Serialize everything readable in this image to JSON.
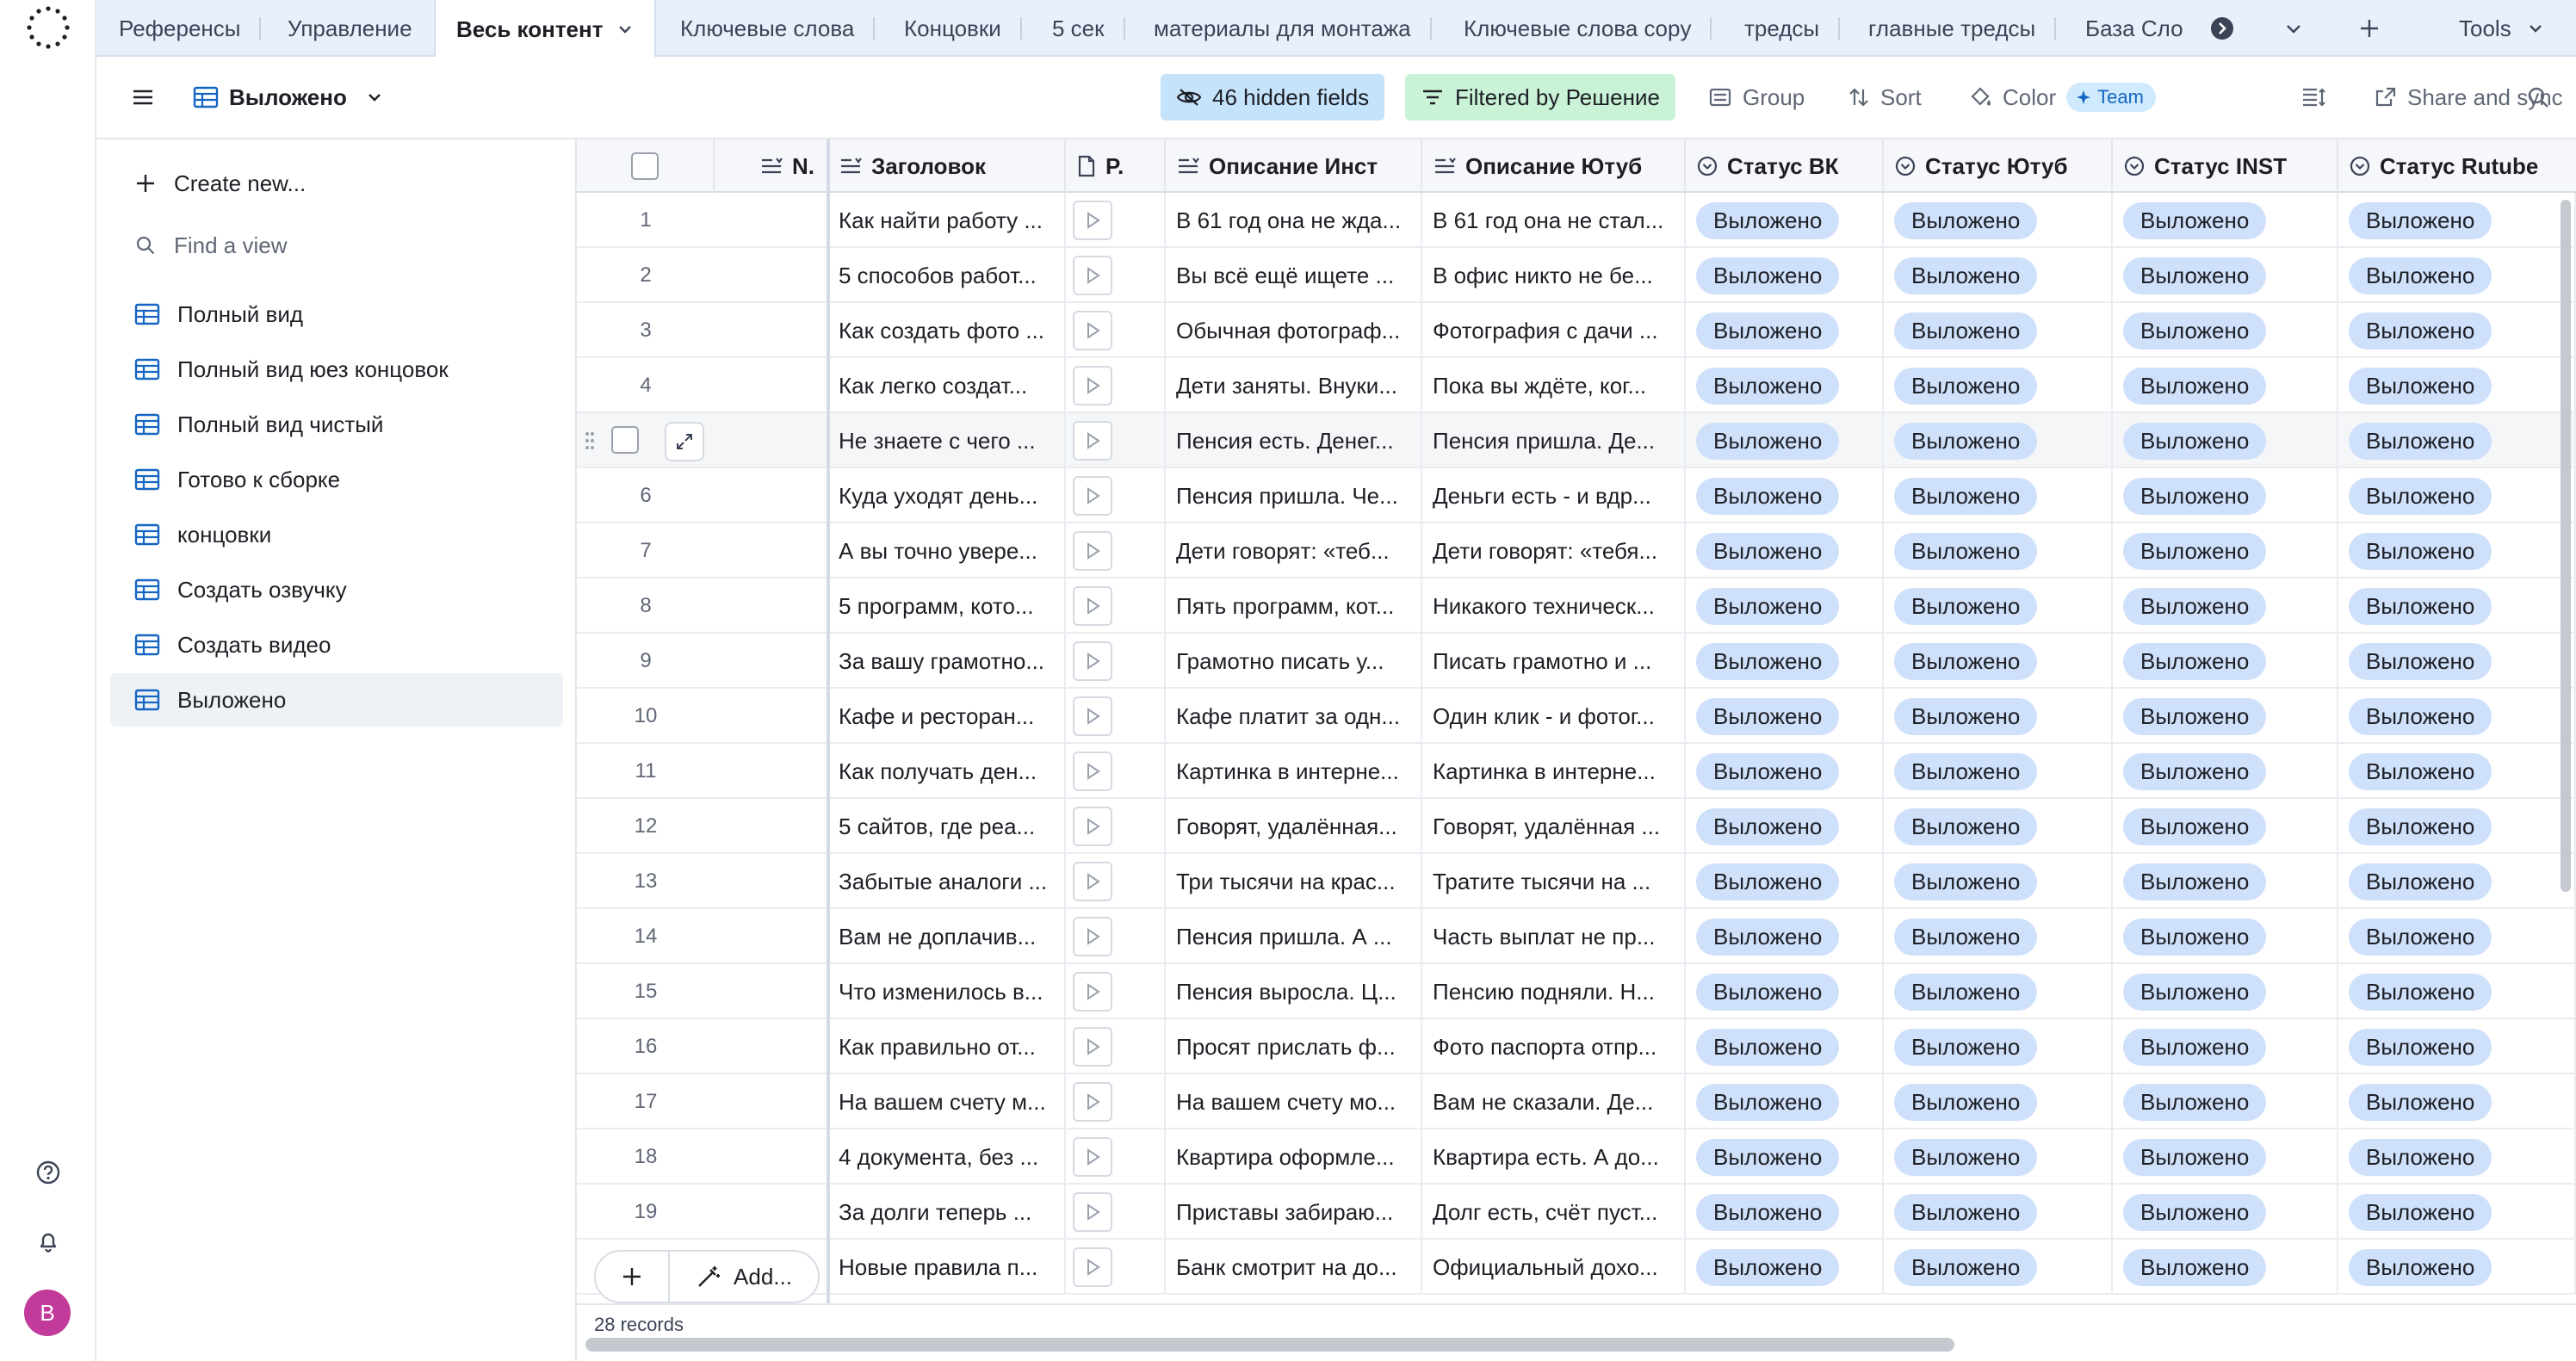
{
  "tabs": {
    "items": [
      "Референсы",
      "Управление",
      "Весь контент",
      "Ключевые слова",
      "Концовки",
      "5 сек",
      "материалы для монтажа",
      "Ключевые слова copy",
      "тредсы",
      "главные тредсы",
      "База Сло"
    ],
    "tools_label": "Tools"
  },
  "toolbar": {
    "view_name": "Выложено",
    "hidden_fields": "46 hidden fields",
    "filter": "Filtered by Решение",
    "group": "Group",
    "sort": "Sort",
    "color": "Color",
    "team": "Team",
    "share": "Share and sync"
  },
  "sidebar": {
    "create_new": "Create new...",
    "find_view": "Find a view",
    "views": [
      "Полный вид",
      "Полный вид юез концовок",
      "Полный вид чистый",
      "Готово к сборке",
      "концовки",
      "Создать озвучку",
      "Создать видео",
      "Выложено"
    ]
  },
  "avatar_letter": "B",
  "grid": {
    "columns": [
      "N.",
      "Заголовок",
      "P.",
      "Описание Инст",
      "Описание Ютуб",
      "Статус ВК",
      "Статус Ютуб",
      "Статус INST",
      "Статус Rutube"
    ],
    "status_value": "Выложено",
    "rows": [
      {
        "n": "1",
        "title": "Как найти работу ...",
        "inst": "В 61 год она не жда...",
        "yt": "В 61 год она не стал..."
      },
      {
        "n": "2",
        "title": "5 способов работ...",
        "inst": "Вы всё ещё ищете ...",
        "yt": "В офис никто не бе..."
      },
      {
        "n": "3",
        "title": "Как создать фото ...",
        "inst": "Обычная фотограф...",
        "yt": "Фотография с дачи ..."
      },
      {
        "n": "4",
        "title": "Как легко создат...",
        "inst": "Дети заняты. Внуки...",
        "yt": "Пока вы ждёте, ког..."
      },
      {
        "n": "",
        "title": "Не знаете с чего ...",
        "inst": "Пенсия есть. Денег...",
        "yt": "Пенсия пришла. Де..."
      },
      {
        "n": "6",
        "title": "Куда уходят день...",
        "inst": "Пенсия пришла. Че...",
        "yt": "Деньги есть - и вдр..."
      },
      {
        "n": "7",
        "title": "А вы точно увере...",
        "inst": "Дети говорят: «теб...",
        "yt": "Дети говорят: «тебя..."
      },
      {
        "n": "8",
        "title": "5 программ, кото...",
        "inst": "Пять программ, кот...",
        "yt": "Никакого техническ..."
      },
      {
        "n": "9",
        "title": "За вашу грамотно...",
        "inst": "Грамотно писать у...",
        "yt": "Писать грамотно и ..."
      },
      {
        "n": "10",
        "title": "Кафе и ресторан...",
        "inst": "Кафе платит за одн...",
        "yt": "Один клик - и фотог..."
      },
      {
        "n": "11",
        "title": "Как получать ден...",
        "inst": "Картинка в интерне...",
        "yt": "Картинка в интерне..."
      },
      {
        "n": "12",
        "title": "5 сайтов, где реа...",
        "inst": "Говорят, удалённая...",
        "yt": "Говорят, удалённая ..."
      },
      {
        "n": "13",
        "title": "Забытые аналоги ...",
        "inst": "Три тысячи на крас...",
        "yt": "Тратите тысячи на ..."
      },
      {
        "n": "14",
        "title": "Вам не доплачив...",
        "inst": "Пенсия пришла. А ...",
        "yt": "Часть выплат не пр..."
      },
      {
        "n": "15",
        "title": "Что изменилось в...",
        "inst": "Пенсия выросла. Ц...",
        "yt": "Пенсию подняли. Н..."
      },
      {
        "n": "16",
        "title": "Как правильно от...",
        "inst": "Просят прислать ф...",
        "yt": "Фото паспорта отпр..."
      },
      {
        "n": "17",
        "title": "На вашем счету м...",
        "inst": "На вашем счету мо...",
        "yt": "Вам не сказали. Де..."
      },
      {
        "n": "18",
        "title": "4 документа, без ...",
        "inst": "Квартира оформле...",
        "yt": "Квартира есть. А до..."
      },
      {
        "n": "19",
        "title": "За долги теперь ...",
        "inst": "Приставы забираю...",
        "yt": "Долг есть, счёт пуст..."
      },
      {
        "n": "",
        "title": "Новые правила п...",
        "inst": "Банк смотрит на до...",
        "yt": "Официальный дохо..."
      }
    ],
    "add_label": "Add...",
    "records_label": "28 records"
  }
}
